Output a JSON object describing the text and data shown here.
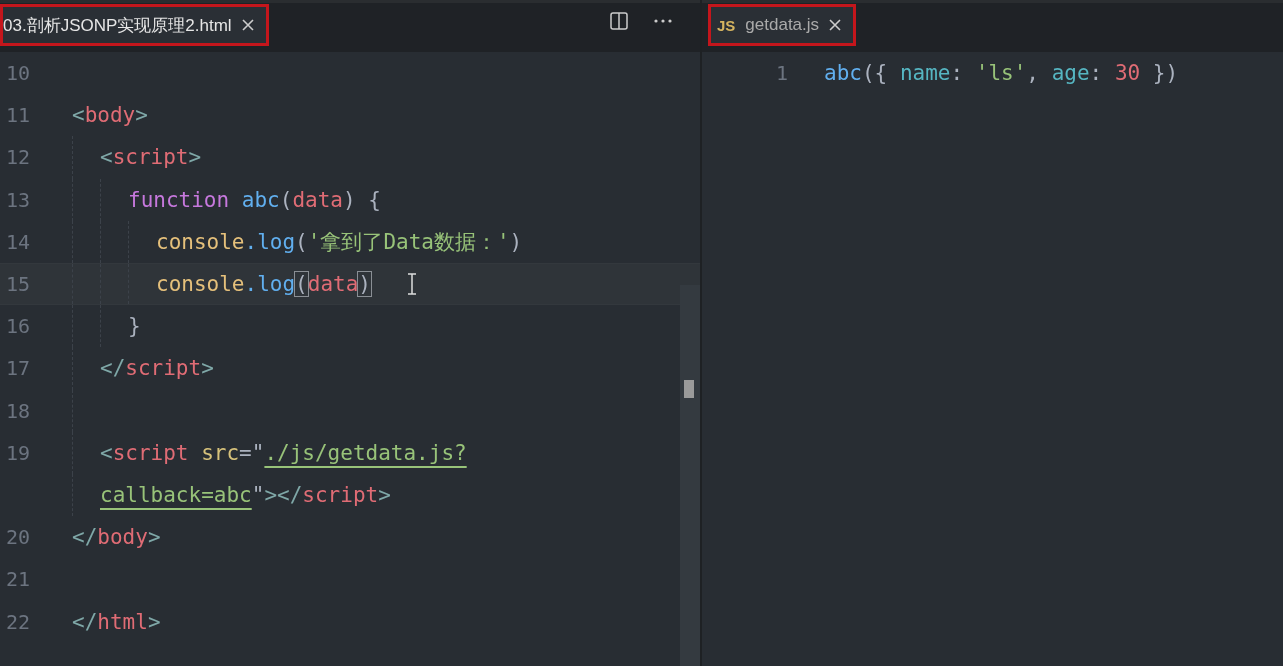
{
  "panes": [
    {
      "tab": {
        "label": "03.剖析JSONP实现原理2.html",
        "selected": true
      },
      "toolbar": true,
      "lines": [
        {
          "number": "10",
          "current": false
        },
        {
          "number": "11",
          "current": false,
          "tokens": [
            {
              "text": "<",
              "kind": "punct"
            },
            {
              "text": "body",
              "kind": "tag"
            },
            {
              "text": ">",
              "kind": "punct"
            }
          ],
          "children": [
            {
              "number": "12",
              "current": false,
              "tokens": [
                {
                  "text": "<",
                  "kind": "punct"
                },
                {
                  "text": "script",
                  "kind": "tag"
                },
                {
                  "text": ">",
                  "kind": "punct"
                }
              ],
              "children": [
                {
                  "number": "13",
                  "current": false,
                  "tokens": [
                    {
                      "text": "function ",
                      "kind": "keyword"
                    },
                    {
                      "text": "abc",
                      "kind": "func"
                    },
                    {
                      "text": "(",
                      "kind": "plain"
                    },
                    {
                      "text": "data",
                      "kind": "param"
                    },
                    {
                      "text": ") {",
                      "kind": "plain"
                    }
                  ],
                  "children": [
                    {
                      "number": "14",
                      "current": false,
                      "tokens": [
                        {
                          "text": "console",
                          "kind": "object"
                        },
                        {
                          "text": ".log",
                          "kind": "func"
                        },
                        {
                          "text": "(",
                          "kind": "plain"
                        },
                        {
                          "text": "'拿到了Data数据：'",
                          "kind": "string"
                        },
                        {
                          "text": ")",
                          "kind": "plain"
                        }
                      ]
                    },
                    {
                      "number": "15",
                      "current": true,
                      "tokens": [
                        {
                          "text": "console",
                          "kind": "object"
                        },
                        {
                          "text": ".log",
                          "kind": "func"
                        },
                        {
                          "text": "(",
                          "kind": "match"
                        },
                        {
                          "text": "data",
                          "kind": "param"
                        },
                        {
                          "text": ")",
                          "kind": "match"
                        }
                      ]
                    }
                  ]
                },
                {
                  "number": "16",
                  "current": false,
                  "tokens": [
                    {
                      "text": "}",
                      "kind": "plain"
                    }
                  ]
                }
              ]
            },
            {
              "number": "17",
              "current": false,
              "tokens": [
                {
                  "text": "</",
                  "kind": "punct"
                },
                {
                  "text": "script",
                  "kind": "tag"
                },
                {
                  "text": ">",
                  "kind": "punct"
                }
              ]
            },
            {
              "number": "18",
              "current": false
            },
            {
              "number": "19",
              "current": false,
              "tokens": [
                {
                  "text": "<",
                  "kind": "punct"
                },
                {
                  "text": "script",
                  "kind": "tag"
                },
                {
                  "text": " src",
                  "kind": "attr"
                },
                {
                  "text": "=\"",
                  "kind": "plain"
                },
                {
                  "text": "./js/getdata.js?",
                  "kind": "link"
                }
              ]
            },
            {
              "current": false,
              "tokens": [
                {
                  "text": "callback=abc",
                  "kind": "link"
                },
                {
                  "text": "\"",
                  "kind": "plain"
                },
                {
                  "text": "></",
                  "kind": "punct"
                },
                {
                  "text": "script",
                  "kind": "tag"
                },
                {
                  "text": ">",
                  "kind": "punct"
                }
              ]
            }
          ]
        },
        {
          "number": "20",
          "current": false,
          "tokens": [
            {
              "text": "</",
              "kind": "punct"
            },
            {
              "text": "body",
              "kind": "tag"
            },
            {
              "text": ">",
              "kind": "punct"
            }
          ]
        },
        {
          "number": "21",
          "current": false
        },
        {
          "number": "22",
          "current": false,
          "tokens": [
            {
              "text": "</",
              "kind": "punct"
            },
            {
              "text": "html",
              "kind": "tag"
            },
            {
              "text": ">",
              "kind": "punct"
            }
          ]
        }
      ]
    },
    {
      "tab": {
        "label": "getdata.js",
        "icon": "JS",
        "selected": true
      },
      "toolbar": false,
      "lines": [
        {
          "number": "1",
          "current": false,
          "tokens": [
            {
              "text": "abc",
              "kind": "func"
            },
            {
              "text": "(",
              "kind": "plain"
            },
            {
              "text": "{ ",
              "kind": "plain"
            },
            {
              "text": "name",
              "kind": "prop"
            },
            {
              "text": ": ",
              "kind": "plain"
            },
            {
              "text": "'ls'",
              "kind": "string"
            },
            {
              "text": ", ",
              "kind": "plain"
            },
            {
              "text": "age",
              "kind": "prop"
            },
            {
              "text": ": ",
              "kind": "plain"
            },
            {
              "text": "30",
              "kind": "number"
            },
            {
              "text": " })",
              "kind": "plain"
            }
          ]
        }
      ]
    }
  ]
}
